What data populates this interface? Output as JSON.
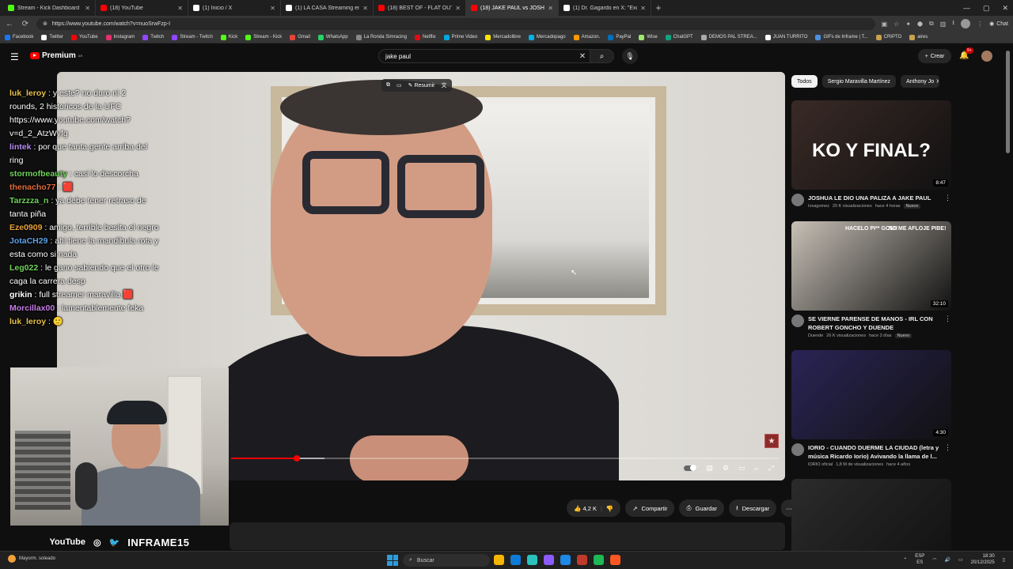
{
  "browser": {
    "tabs": [
      {
        "label": "Stream - Kick Dashboard",
        "color": "#53fc18",
        "active": false
      },
      {
        "label": "(18) YouTube",
        "color": "#ff0000",
        "active": false
      },
      {
        "label": "(1) Inicio / X",
        "color": "#ffffff",
        "active": false
      },
      {
        "label": "(1) LA CASA Streaming en X: \"Nad",
        "color": "#ffffff",
        "active": false
      },
      {
        "label": "(18) BEST OF - FLAT OUT | WRC Ra",
        "color": "#ff0000",
        "active": false
      },
      {
        "label": "(18) JAKE PAUL vs JOSHUA?",
        "color": "#ff0000",
        "active": true
      },
      {
        "label": "(1) Dr. Gagardo en X: \"Excelente. Gr",
        "color": "#ffffff",
        "active": false
      }
    ],
    "url": "https://www.youtube.com/watch?v=nuoSrwFzp-I",
    "chat_button": "Chat",
    "bookmarks": [
      {
        "label": "Facebook",
        "color": "#1877f2"
      },
      {
        "label": "Twitter",
        "color": "#ffffff"
      },
      {
        "label": "YouTube",
        "color": "#ff0000"
      },
      {
        "label": "Instagram",
        "color": "#e1306c"
      },
      {
        "label": "Twitch",
        "color": "#9146ff"
      },
      {
        "label": "Stream - Twitch",
        "color": "#9146ff"
      },
      {
        "label": "Kick",
        "color": "#53fc18"
      },
      {
        "label": "Stream - Kick",
        "color": "#53fc18"
      },
      {
        "label": "Gmail",
        "color": "#ea4335"
      },
      {
        "label": "WhatsApp",
        "color": "#25d366"
      },
      {
        "label": "La Ronda Simracing",
        "color": "#888888"
      },
      {
        "label": "Netflix",
        "color": "#e50914"
      },
      {
        "label": "Prime Video",
        "color": "#00a8e1"
      },
      {
        "label": "Mercadolibre",
        "color": "#ffe600"
      },
      {
        "label": "Mercadopago",
        "color": "#00b1ea"
      },
      {
        "label": "Amazon.",
        "color": "#ff9900"
      },
      {
        "label": "PayPal",
        "color": "#0070ba"
      },
      {
        "label": "Wise",
        "color": "#9fe870"
      },
      {
        "label": "ChatGPT",
        "color": "#10a37f"
      },
      {
        "label": "DEMOS PAL STREA...",
        "color": "#aaaaaa"
      },
      {
        "label": "JUAN TURRITO",
        "color": "#ffffff"
      },
      {
        "label": "GIFs de Inframe | T...",
        "color": "#4a90e2"
      },
      {
        "label": "CRIPTO",
        "color": "#c8a24b"
      },
      {
        "label": "aires",
        "color": "#c8a24b"
      }
    ]
  },
  "youtube": {
    "logo_text": "Premium",
    "logo_sup": "AR",
    "search_value": "jake paul",
    "create_label": "Crear",
    "notif_badge": "9+",
    "video": {
      "toolbar_label": "Resumir",
      "progress": 0.12,
      "buffered": 0.17
    },
    "actions": {
      "likes": "4,2 K",
      "share": "Compartir",
      "save": "Guardar",
      "download": "Descargar"
    },
    "chips": [
      "Todos",
      "Sergio Maravilla Martínez",
      "Anthony Jo"
    ],
    "recommendations": [
      {
        "thumb_text": "KO Y FINAL?",
        "duration": "8:47",
        "title": "JOSHUA LE DIO UNA PALIZA A JAKE PAUL",
        "channel": "Iosagomez",
        "views": "20 K visualizaciones",
        "age": "hace 4 horas",
        "badge": "Nuevo",
        "bg": "#3a2a26"
      },
      {
        "thumb_text": "HACELO PI** GON!!",
        "thumb_text2": "NO ME AFLOJE PIBE!",
        "duration": "32:10",
        "title": "SE VIERNE PARENSE DE MANOS - IRL CON ROBERT GONCHO Y DUENDE",
        "channel": "Duende",
        "views": "26 K visualizaciones",
        "age": "hace 3 días",
        "badge": "Nuevo",
        "bg": "#c7c0b6"
      },
      {
        "thumb_text": "",
        "duration": "4:30",
        "title": "IORIO - CUANDO DUERME LA CIUDAD (letra y música Ricardo Iorio) Avivando la llama de l...",
        "channel": "IORIO oficial",
        "views": "1,8 M de visualizaciones",
        "age": "hace 4 años",
        "badge": "",
        "bg": "#2a2456"
      },
      {
        "thumb_text": "",
        "duration": "",
        "title": "",
        "channel": "",
        "views": "",
        "age": "",
        "badge": "",
        "bg": "#2b2b2b"
      }
    ]
  },
  "chat": [
    {
      "user": "luk_leroy",
      "color": "#e8c04a",
      "text": ": y este? no duro ni 2"
    },
    {
      "user": "",
      "color": "#ffffff",
      "text": "rounds, 2 historicos de la UFC"
    },
    {
      "user": "",
      "color": "#ffffff",
      "text": "https://www.youtube.com/watch?"
    },
    {
      "user": "",
      "color": "#ffffff",
      "text": "v=d_2_AtzWyfg"
    },
    {
      "user": "lintek",
      "color": "#b48df2",
      "text": ": por que tanta gente arriba del"
    },
    {
      "user": "",
      "color": "#ffffff",
      "text": "ring"
    },
    {
      "user": "stormofbeauty",
      "color": "#6fd35a",
      "text": ": casi lo descorcha"
    },
    {
      "user": "thenacho77",
      "color": "#e06a3b",
      "text": ": 🟥"
    },
    {
      "user": "Tarzzza_n",
      "color": "#6fd35a",
      "text": ": ya debe tener retraso de"
    },
    {
      "user": "",
      "color": "#ffffff",
      "text": "tanta piña"
    },
    {
      "user": "Eze0909",
      "color": "#e8a23a",
      "text": ": amigo, terrible besita el negro"
    },
    {
      "user": "JotaCH29",
      "color": "#5aa0e8",
      "text": ": ahi tiene la mandibula rota y"
    },
    {
      "user": "",
      "color": "#ffffff",
      "text": "esta como si nada"
    },
    {
      "user": "Leg022",
      "color": "#6fd35a",
      "text": ": le gano sabiendo que el otro le"
    },
    {
      "user": "",
      "color": "#ffffff",
      "text": "caga la carrera desp"
    },
    {
      "user": "grikin",
      "color": "#ffffff",
      "text": ": full streamer maravilla 🟥"
    },
    {
      "user": "Morcillax00",
      "color": "#c77de8",
      "text": ": lamentablemente feka"
    },
    {
      "user": "luk_leroy",
      "color": "#e8c04a",
      "text": ": 🙂"
    }
  ],
  "stream_overlay": {
    "platform": "YouTube",
    "handle": "INFRAME15"
  },
  "taskbar": {
    "weather": "Mayorm. soleado",
    "search": "Buscar",
    "lang_top": "ESP",
    "lang_bottom": "ES",
    "time": "18:30",
    "date": "20/12/2025",
    "apps": [
      "#f5b400",
      "#0f7bd6",
      "#2ac1bc",
      "#8a5cff",
      "#1e88e5",
      "#c0392b",
      "#1db954",
      "#ff5722"
    ]
  }
}
